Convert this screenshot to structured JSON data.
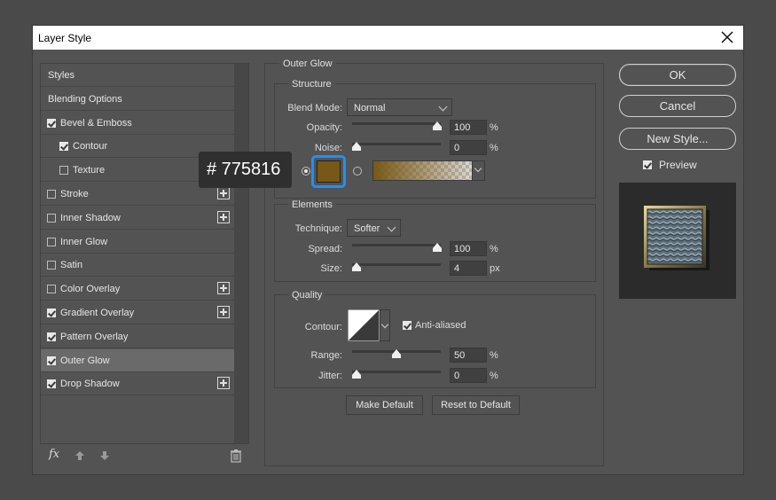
{
  "window": {
    "title": "Layer Style"
  },
  "styles_list": {
    "items": [
      {
        "label": "Styles",
        "checkbox": false,
        "checked": false,
        "add": false,
        "active": false,
        "indent": false
      },
      {
        "label": "Blending Options",
        "checkbox": false,
        "checked": false,
        "add": false,
        "active": false,
        "indent": false
      },
      {
        "label": "Bevel & Emboss",
        "checkbox": true,
        "checked": true,
        "add": false,
        "active": false,
        "indent": false
      },
      {
        "label": "Contour",
        "checkbox": true,
        "checked": true,
        "add": false,
        "active": false,
        "indent": true
      },
      {
        "label": "Texture",
        "checkbox": true,
        "checked": false,
        "add": false,
        "active": false,
        "indent": true
      },
      {
        "label": "Stroke",
        "checkbox": true,
        "checked": false,
        "add": true,
        "active": false,
        "indent": false
      },
      {
        "label": "Inner Shadow",
        "checkbox": true,
        "checked": false,
        "add": true,
        "active": false,
        "indent": false
      },
      {
        "label": "Inner Glow",
        "checkbox": true,
        "checked": false,
        "add": false,
        "active": false,
        "indent": false
      },
      {
        "label": "Satin",
        "checkbox": true,
        "checked": false,
        "add": false,
        "active": false,
        "indent": false
      },
      {
        "label": "Color Overlay",
        "checkbox": true,
        "checked": false,
        "add": true,
        "active": false,
        "indent": false
      },
      {
        "label": "Gradient Overlay",
        "checkbox": true,
        "checked": true,
        "add": true,
        "active": false,
        "indent": false
      },
      {
        "label": "Pattern Overlay",
        "checkbox": true,
        "checked": true,
        "add": false,
        "active": false,
        "indent": false
      },
      {
        "label": "Outer Glow",
        "checkbox": true,
        "checked": true,
        "add": false,
        "active": true,
        "indent": false
      },
      {
        "label": "Drop Shadow",
        "checkbox": true,
        "checked": true,
        "add": true,
        "active": false,
        "indent": false
      }
    ],
    "fx_label": "fx"
  },
  "tooltip": {
    "text": "# 775816"
  },
  "outer_glow": {
    "title": "Outer Glow",
    "structure": {
      "title": "Structure",
      "blend_mode_label": "Blend Mode:",
      "blend_mode_value": "Normal",
      "opacity_label": "Opacity:",
      "opacity_value": "100",
      "noise_label": "Noise:",
      "noise_value": "0",
      "percent": "%",
      "glow_color": "#775816"
    },
    "elements": {
      "title": "Elements",
      "technique_label": "Technique:",
      "technique_value": "Softer",
      "spread_label": "Spread:",
      "spread_value": "100",
      "size_label": "Size:",
      "size_value": "4",
      "percent": "%",
      "px": "px"
    },
    "quality": {
      "title": "Quality",
      "contour_label": "Contour:",
      "anti_aliased_label": "Anti-aliased",
      "anti_aliased_checked": true,
      "range_label": "Range:",
      "range_value": "50",
      "jitter_label": "Jitter:",
      "jitter_value": "0",
      "percent": "%"
    },
    "make_default": "Make Default",
    "reset_to_default": "Reset to Default"
  },
  "right": {
    "ok": "OK",
    "cancel": "Cancel",
    "new_style": "New Style...",
    "preview_label": "Preview",
    "preview_checked": true
  }
}
